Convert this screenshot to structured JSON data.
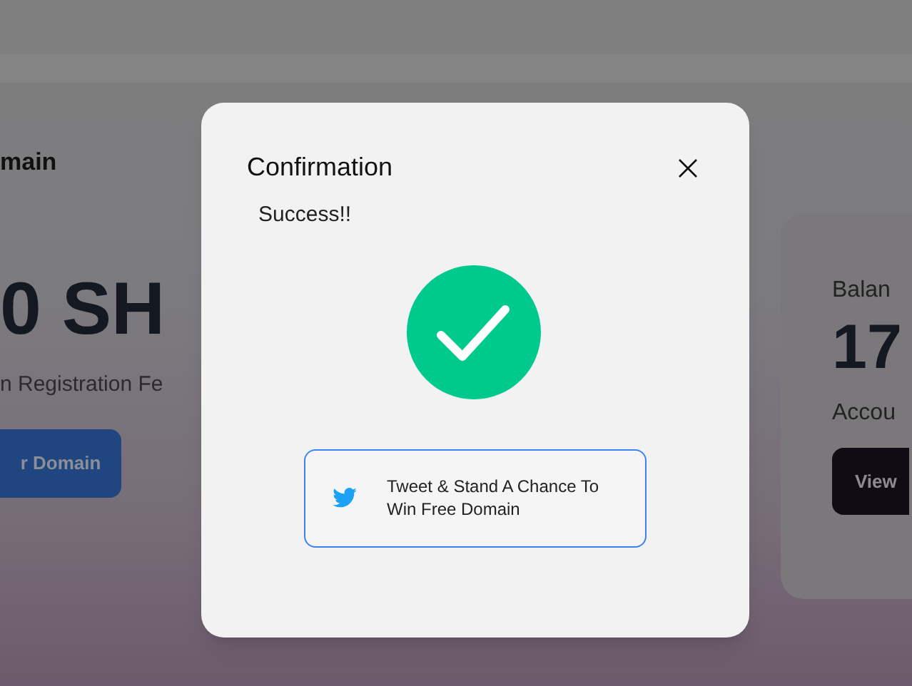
{
  "background": {
    "section_title": "main",
    "price": "0 SH",
    "fee_label": "n Registration Fe",
    "register_button": "r Domain",
    "balance_label": "Balan",
    "balance_value": "17",
    "account_label": "Accou",
    "view_button": "View"
  },
  "dialog": {
    "title": "Confirmation",
    "message": "Success!!",
    "tweet_button": "Tweet & Stand A Chance To Win Free Domain"
  }
}
